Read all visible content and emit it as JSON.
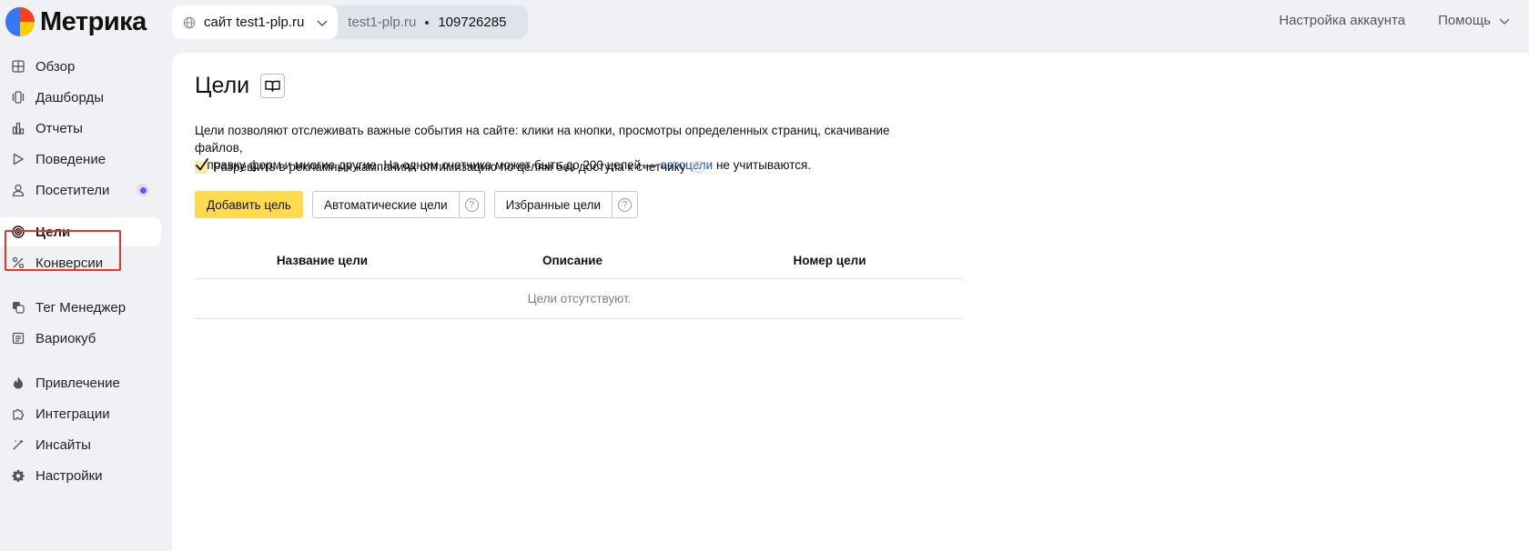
{
  "header": {
    "logo_text": "Метрика",
    "site_select_label": "сайт test1-plp.ru",
    "counter_domain": "test1-plp.ru",
    "counter_id": "109726285",
    "account_settings": "Настройка аккаунта",
    "help": "Помощь"
  },
  "sidebar": {
    "items": [
      {
        "label": "Обзор",
        "icon": "grid-icon"
      },
      {
        "label": "Дашборды",
        "icon": "dashboards-icon"
      },
      {
        "label": "Отчеты",
        "icon": "bar-chart-icon"
      },
      {
        "label": "Поведение",
        "icon": "play-icon"
      },
      {
        "label": "Посетители",
        "icon": "person-icon"
      },
      {
        "label": "Цели",
        "icon": "target-icon",
        "active": true
      },
      {
        "label": "Конверсии",
        "icon": "percent-icon"
      },
      {
        "label": "Тег Менеджер",
        "icon": "tag-manager-icon"
      },
      {
        "label": "Вариокуб",
        "icon": "variocube-icon"
      },
      {
        "label": "Привлечение",
        "icon": "flame-icon"
      },
      {
        "label": "Интеграции",
        "icon": "puzzle-icon"
      },
      {
        "label": "Инсайты",
        "icon": "insights-icon"
      },
      {
        "label": "Настройки",
        "icon": "gear-icon"
      }
    ]
  },
  "main": {
    "title": "Цели",
    "description_part1": "Цели позволяют отслеживать важные события на сайте: клики на кнопки, просмотры определенных страниц, скачивание файлов,",
    "description_part2": "отправку форм и многие другие. На одном счетчике может быть до 200 целей — ",
    "description_link": "автоцели",
    "description_part3": " не учитываются.",
    "optimization_checkbox_label": "Разрешить в рекламных кампаниях оптимизацию по целям без доступа к счетчику",
    "optimization_checked": true,
    "buttons": {
      "add_goal": "Добавить цель",
      "auto_goals": "Автоматические цели",
      "favorite_goals": "Избранные цели",
      "help_glyph": "?"
    },
    "table": {
      "columns": [
        "Название цели",
        "Описание",
        "Номер цели"
      ],
      "empty_text": "Цели отсутствуют."
    }
  },
  "colors": {
    "accent_yellow": "#ffdb4d",
    "link_blue": "#1f57c3",
    "highlight_red": "#e8352e",
    "badge_purple": "#7a4cf2"
  }
}
